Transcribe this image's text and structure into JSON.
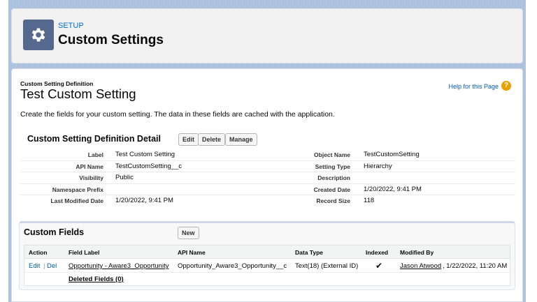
{
  "header": {
    "setup_label": "SETUP",
    "title": "Custom Settings"
  },
  "page": {
    "subtitle": "Custom Setting Definition",
    "title": "Test Custom Setting",
    "help_link": "Help for this Page",
    "description": "Create the fields for your custom setting. The data in these fields are cached with the application."
  },
  "detail": {
    "section_title": "Custom Setting Definition Detail",
    "buttons": {
      "edit": "Edit",
      "delete": "Delete",
      "manage": "Manage"
    },
    "left": [
      {
        "label": "Label",
        "value": "Test Custom Setting"
      },
      {
        "label": "API Name",
        "value": "TestCustomSetting__c"
      },
      {
        "label": "Visibility",
        "value": "Public"
      },
      {
        "label": "Namespace Prefix",
        "value": ""
      },
      {
        "label": "Last Modified Date",
        "value": "1/20/2022, 9:41 PM"
      }
    ],
    "right": [
      {
        "label": "Object Name",
        "value": "TestCustomSetting"
      },
      {
        "label": "Setting Type",
        "value": "Hierarchy"
      },
      {
        "label": "Description",
        "value": ""
      },
      {
        "label": "Created Date",
        "value": "1/20/2022, 9:41 PM"
      },
      {
        "label": "Record Size",
        "value": "118"
      }
    ]
  },
  "custom_fields": {
    "section_title": "Custom Fields",
    "new_button": "New",
    "columns": [
      "Action",
      "Field Label",
      "API Name",
      "Data Type",
      "Indexed",
      "Modified By"
    ],
    "rows": [
      {
        "action_edit": "Edit",
        "action_sep": "|",
        "action_del": "Del",
        "field_label": "Opportunity - Aware3_Opportunity",
        "api_name": "Opportunity_Aware3_Opportunity__c",
        "data_type": "Text(18) (External ID)",
        "indexed": "✔",
        "modified_by_name": "Jason Atwood",
        "modified_by_date": ", 1/22/2022, 11:20 AM"
      }
    ],
    "deleted_fields": "Deleted Fields (0)"
  },
  "colors": {
    "brand_icon_bg": "#54698d",
    "link": "#015ba7",
    "help_icon": "#e8a100"
  }
}
